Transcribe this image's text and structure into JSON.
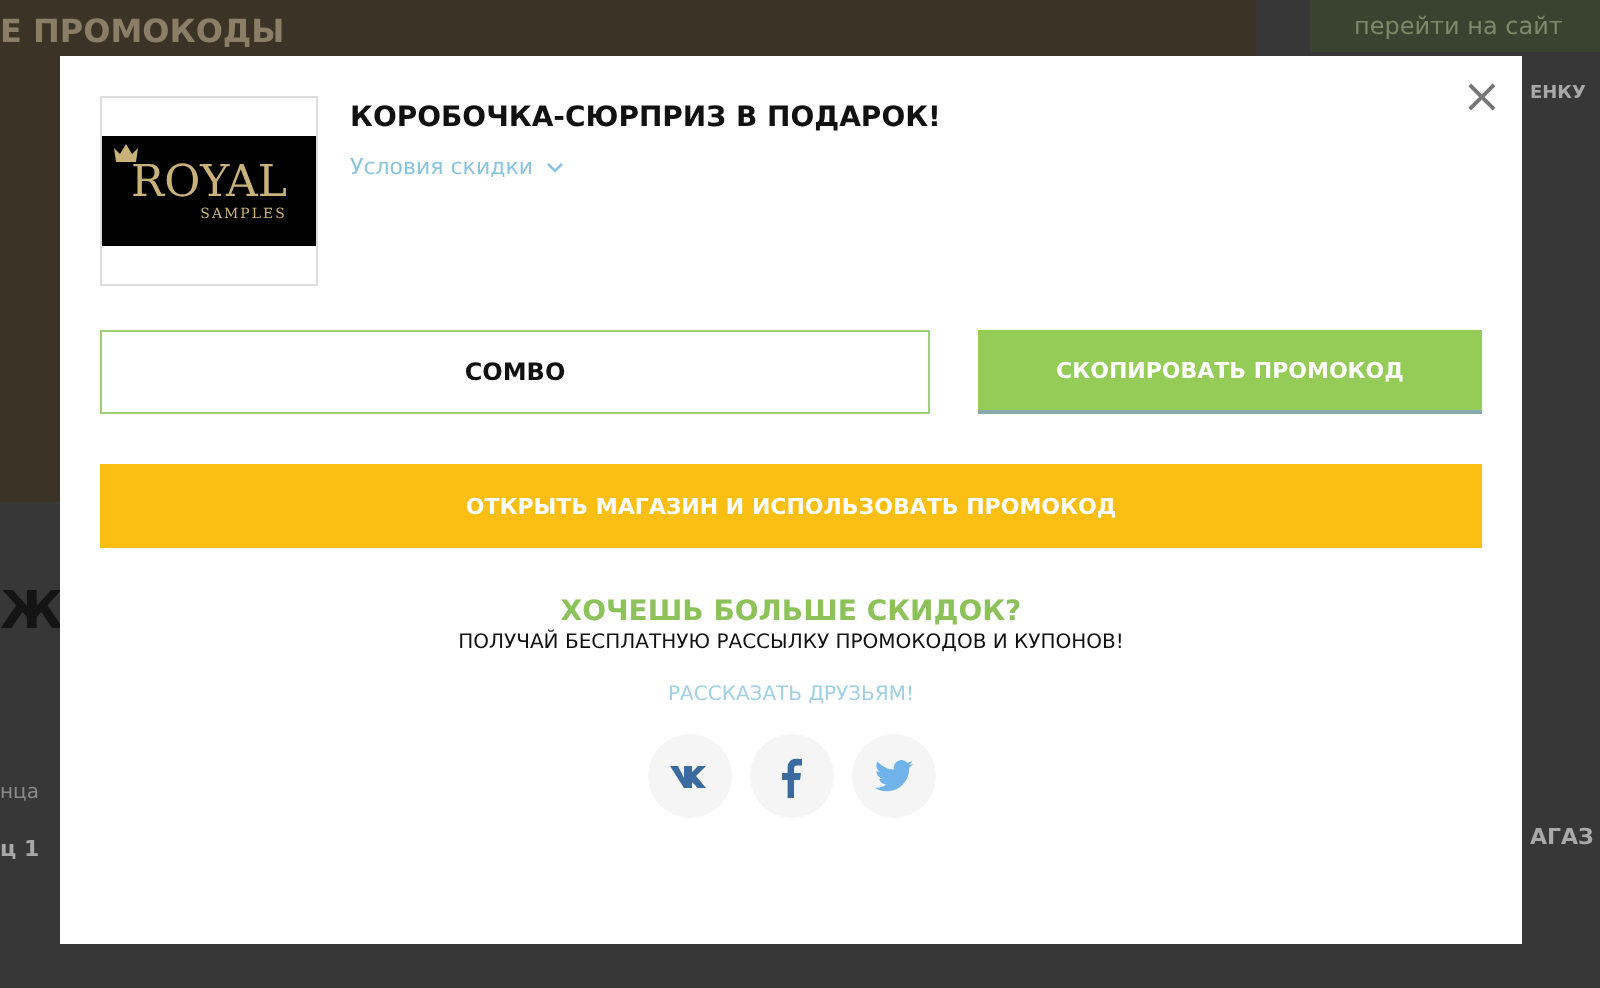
{
  "background_page": {
    "header_title": "Е ПРОМОКОДЫ",
    "site_button": "перейти на сайт",
    "rating_label": "ЕНКУ",
    "big_letter": "Ж",
    "small_text": "нца",
    "bold_text": "ц 1",
    "shop_label": "АГАЗ"
  },
  "modal": {
    "close": "×",
    "logo": {
      "line1": "ROYAL",
      "line2": "SAMPLES"
    },
    "title": "КОРОБОЧКА-СЮРПРИЗ В ПОДАРОК!",
    "conditions_link": "Условия скидки",
    "conditions_expanded": false,
    "promo_code": "COMBO",
    "copy_button": "СКОПИРОВАТЬ ПРОМОКОД",
    "open_shop_button": "ОТКРЫТЬ МАГАЗИН И ИСПОЛЬЗОВАТЬ ПРОМОКОД",
    "subscribe_heading": "ХОЧЕШЬ БОЛЬШЕ СКИДОК?",
    "subscribe_text": "ПОЛУЧАЙ БЕСПЛАТНУЮ РАССЫЛКУ ПРОМОКОДОВ И КУПОНОВ!",
    "share_link": "РАССКАЗАТЬ ДРУЗЬЯМ!",
    "social": [
      {
        "kind": "vk"
      },
      {
        "kind": "facebook"
      },
      {
        "kind": "twitter"
      }
    ]
  }
}
